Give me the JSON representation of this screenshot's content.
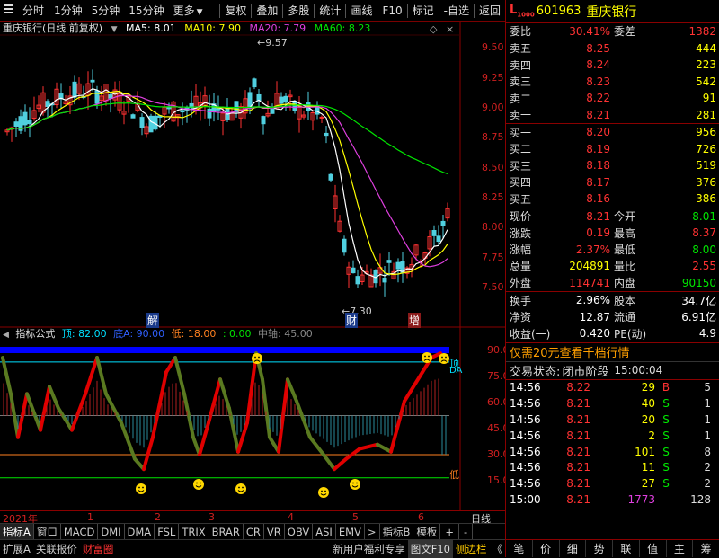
{
  "toolbar": {
    "left": [
      "分时",
      "1分钟",
      "5分钟",
      "15分钟",
      "更多"
    ],
    "right": [
      "复权",
      "叠加",
      "多股",
      "统计",
      "画线",
      "F10",
      "标记",
      "-自选",
      "返回"
    ]
  },
  "main_legend": {
    "title": "重庆银行(日线 前复权)",
    "ma5": "MA5: 8.01",
    "ma10": "MA10: 7.90",
    "ma20": "MA20: 7.79",
    "ma60": "MA60: 8.23"
  },
  "main_yaxis": [
    "9.50",
    "9.25",
    "9.00",
    "8.75",
    "8.50",
    "8.25",
    "8.00",
    "7.75",
    "7.50"
  ],
  "annotations": {
    "high": "9.57",
    "low": "7.30",
    "jie": "解",
    "cai": "财",
    "zeng": "增"
  },
  "ind_legend": {
    "name": "指标公式",
    "ding": "顶: 82.00",
    "diA": "底A: 90.00",
    "di": "低: 18.00",
    "zero": ": 0.00",
    "mid": "中轴: 45.00"
  },
  "ind_yaxis": [
    "90.00",
    "75.00",
    "60.00",
    "45.00",
    "30.00",
    "15.00"
  ],
  "ind_marks": {
    "ding_side": "顶",
    "diA_side": "DA",
    "di_side": "低"
  },
  "xaxis": {
    "year": "2021年",
    "months": [
      "1",
      "2",
      "3",
      "4",
      "5",
      "6"
    ],
    "period": "日线"
  },
  "tabs": [
    "指标A",
    "窗口",
    "MACD",
    "DMI",
    "DMA",
    "FSL",
    "TRIX",
    "BRAR",
    "CR",
    "VR",
    "OBV",
    "ASI",
    "EMV",
    ">",
    "指标B",
    "模板",
    "+",
    "-"
  ],
  "bottom": {
    "expand": "扩展A",
    "related": "关联报价",
    "wealth": "财富圈",
    "promo": "新用户福利专享",
    "f10": "图文F10",
    "sidebar": "侧边栏",
    "chevron": "《"
  },
  "quote": {
    "logo": "L",
    "logo_sub": "1000",
    "code": "601963",
    "name": "重庆银行",
    "webi_label": "委比",
    "webi": "30.41%",
    "weicha_label": "委差",
    "weicha": "1382",
    "asks": [
      {
        "label": "卖五",
        "price": "8.25",
        "vol": "444"
      },
      {
        "label": "卖四",
        "price": "8.24",
        "vol": "223"
      },
      {
        "label": "卖三",
        "price": "8.23",
        "vol": "542"
      },
      {
        "label": "卖二",
        "price": "8.22",
        "vol": "91"
      },
      {
        "label": "卖一",
        "price": "8.21",
        "vol": "281"
      }
    ],
    "bids": [
      {
        "label": "买一",
        "price": "8.20",
        "vol": "956"
      },
      {
        "label": "买二",
        "price": "8.19",
        "vol": "726"
      },
      {
        "label": "买三",
        "price": "8.18",
        "vol": "519"
      },
      {
        "label": "买四",
        "price": "8.17",
        "vol": "376"
      },
      {
        "label": "买五",
        "price": "8.16",
        "vol": "386"
      }
    ],
    "stats": [
      {
        "l1": "现价",
        "v1": "8.21",
        "c1": "red",
        "l2": "今开",
        "v2": "8.01",
        "c2": "grn"
      },
      {
        "l1": "涨跌",
        "v1": "0.19",
        "c1": "red",
        "l2": "最高",
        "v2": "8.37",
        "c2": "red"
      },
      {
        "l1": "涨幅",
        "v1": "2.37%",
        "c1": "red",
        "l2": "最低",
        "v2": "8.00",
        "c2": "grn"
      },
      {
        "l1": "总量",
        "v1": "204891",
        "c1": "yel",
        "l2": "量比",
        "v2": "2.55",
        "c2": "red"
      },
      {
        "l1": "外盘",
        "v1": "114741",
        "c1": "red",
        "l2": "内盘",
        "v2": "90150",
        "c2": "grn"
      }
    ],
    "stats2": [
      {
        "l1": "换手",
        "v1": "2.96%",
        "l2": "股本",
        "v2": "34.7亿"
      },
      {
        "l1": "净资",
        "v1": "12.87",
        "l2": "流通",
        "v2": "6.91亿"
      },
      {
        "l1": "收益(一)",
        "v1": "0.420",
        "l2": "PE(动)",
        "v2": "4.9"
      }
    ],
    "promo": "仅需20元查看千档行情",
    "status_label": "交易状态:",
    "status": "闭市阶段",
    "status_time": "15:00:04",
    "ticks": [
      {
        "t": "14:56",
        "p": "8.22",
        "v": "29",
        "s": "B",
        "n": "5"
      },
      {
        "t": "14:56",
        "p": "8.21",
        "v": "40",
        "s": "S",
        "n": "1"
      },
      {
        "t": "14:56",
        "p": "8.21",
        "v": "20",
        "s": "S",
        "n": "1"
      },
      {
        "t": "14:56",
        "p": "8.21",
        "v": "2",
        "s": "S",
        "n": "1"
      },
      {
        "t": "14:56",
        "p": "8.21",
        "v": "101",
        "s": "S",
        "n": "8"
      },
      {
        "t": "14:56",
        "p": "8.21",
        "v": "11",
        "s": "S",
        "n": "2"
      },
      {
        "t": "14:56",
        "p": "8.21",
        "v": "27",
        "s": "S",
        "n": "2"
      },
      {
        "t": "15:00",
        "p": "8.21",
        "v": "1773",
        "s": "",
        "n": "128"
      }
    ],
    "rtabs": [
      "笔",
      "价",
      "细",
      "势",
      "联",
      "值",
      "主",
      "筹"
    ]
  }
}
